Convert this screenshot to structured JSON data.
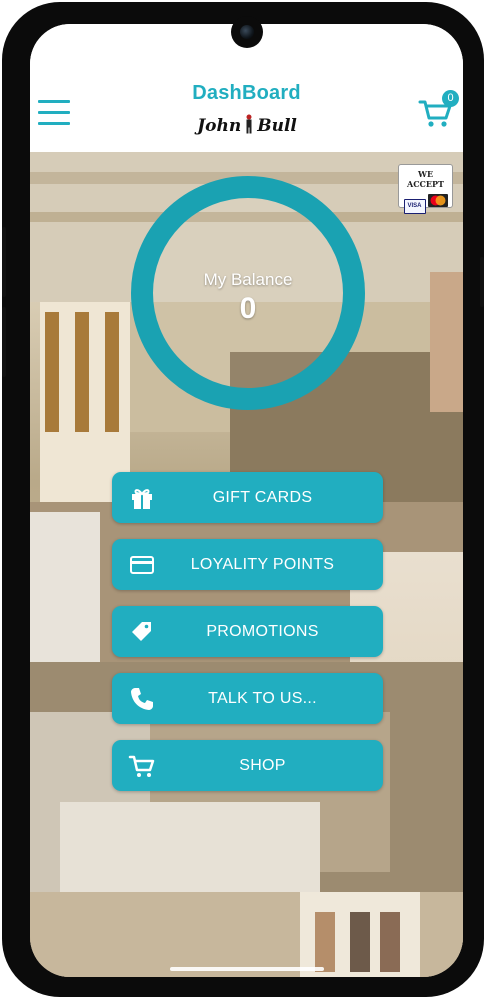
{
  "header": {
    "title": "DashBoard",
    "logo_text": "John Bull",
    "cart_count": "0"
  },
  "payment_badge": {
    "text": "WE ACCEPT",
    "cards": [
      "VISA",
      "MasterCard"
    ]
  },
  "balance": {
    "label": "My Balance",
    "value": "0"
  },
  "menu": [
    {
      "label": "GIFT CARDS",
      "icon": "gift-icon"
    },
    {
      "label": "LOYALITY POINTS",
      "icon": "credit-card-icon"
    },
    {
      "label": "PROMOTIONS",
      "icon": "tag-icon"
    },
    {
      "label": "TALK TO US...",
      "icon": "phone-icon"
    },
    {
      "label": "SHOP",
      "icon": "cart-icon"
    }
  ],
  "colors": {
    "accent": "#21aec0",
    "ring": "#1aa2b2",
    "bezel": "#0b0b0b"
  }
}
